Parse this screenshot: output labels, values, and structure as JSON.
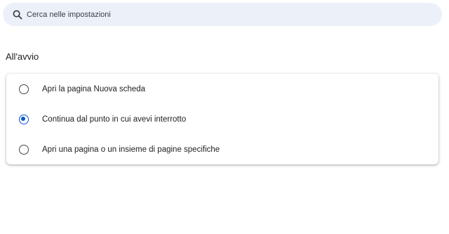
{
  "search": {
    "placeholder": "Cerca nelle impostazioni",
    "icon": "search-icon"
  },
  "startup": {
    "title": "All'avvio",
    "options": [
      {
        "label": "Apri la pagina Nuova scheda",
        "selected": false
      },
      {
        "label": "Continua dal punto in cui avevi interrotto",
        "selected": true
      },
      {
        "label": "Apri una pagina o un insieme di pagine specifiche",
        "selected": false
      }
    ]
  },
  "colors": {
    "accent": "#0b57d0",
    "search_background": "#ecf0f9",
    "text": "#202124"
  }
}
